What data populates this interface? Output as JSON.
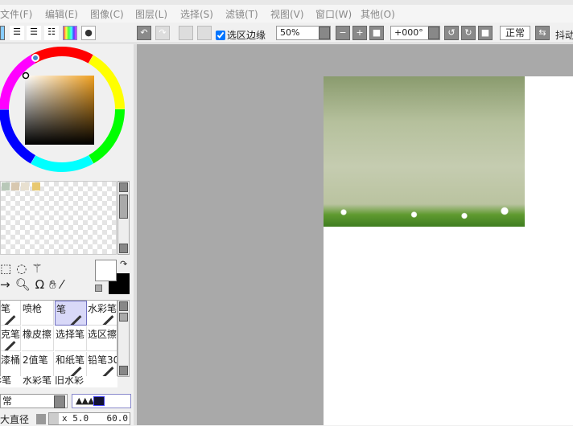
{
  "menu": [
    "文件(F)",
    "编辑(E)",
    "图像(C)",
    "图层(L)",
    "选择(S)",
    "滤镜(T)",
    "视图(V)",
    "窗口(W)",
    "其他(O)"
  ],
  "toolbar": {
    "selection_edge_label": "选区边缘",
    "selection_edge_checked": true,
    "zoom": "50%",
    "rotation": "+000°",
    "blend_label": "正常",
    "stabilizer_label": "抖动"
  },
  "tools": [
    [
      "笔",
      "喷枪",
      "笔",
      "水彩笔"
    ],
    [
      "克笔",
      "橡皮擦",
      "选择笔",
      "选区擦"
    ],
    [
      "漆桶",
      "2值笔",
      "和纸笔",
      "铅笔30"
    ],
    [
      "彩笔",
      "水彩笔",
      "旧水彩",
      ""
    ]
  ],
  "selected_tool": "笔",
  "brush": {
    "mode": "常",
    "size_label": "大直径",
    "size_multiplier": "x 5.0",
    "size_value": "60.0"
  },
  "colors": {
    "primary": "#ffffff",
    "secondary": "#000000",
    "swatches": [
      "#b8c8b8",
      "#d8c8b0",
      "#e8e0d0",
      "#e8c870"
    ]
  }
}
